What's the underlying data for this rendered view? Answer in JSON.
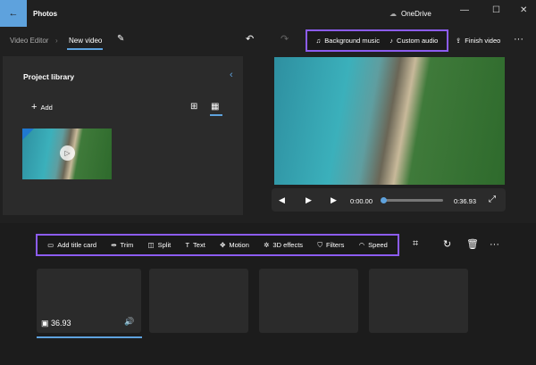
{
  "app": {
    "title": "Photos",
    "onedrive": "OneDrive"
  },
  "window": {
    "minimize": "—",
    "maximize": "☐",
    "close": "✕"
  },
  "breadcrumb": {
    "parent": "Video Editor",
    "current": "New video"
  },
  "toolbar": {
    "background_music": "Background music",
    "custom_audio": "Custom audio",
    "finish_video": "Finish video",
    "more": "···"
  },
  "library": {
    "title": "Project library",
    "add": "Add"
  },
  "player": {
    "current_time": "0:00.00",
    "duration": "0:36.93",
    "progress": 0
  },
  "edit_tools": [
    {
      "label": "Add title card",
      "icon": "title-card-icon",
      "glyph": "▭"
    },
    {
      "label": "Trim",
      "icon": "trim-icon",
      "glyph": "⇹"
    },
    {
      "label": "Split",
      "icon": "split-icon",
      "glyph": "◫"
    },
    {
      "label": "Text",
      "icon": "text-icon",
      "glyph": "T"
    },
    {
      "label": "Motion",
      "icon": "motion-icon",
      "glyph": "✥"
    },
    {
      "label": "3D effects",
      "icon": "3d-effects-icon",
      "glyph": "✲"
    },
    {
      "label": "Filters",
      "icon": "filters-icon",
      "glyph": "⛉"
    },
    {
      "label": "Speed",
      "icon": "speed-icon",
      "glyph": "◠"
    }
  ],
  "storyboard": {
    "clip_duration": "36.93"
  },
  "colors": {
    "accent": "#5ea2dd",
    "highlight": "#8c5cf0"
  }
}
